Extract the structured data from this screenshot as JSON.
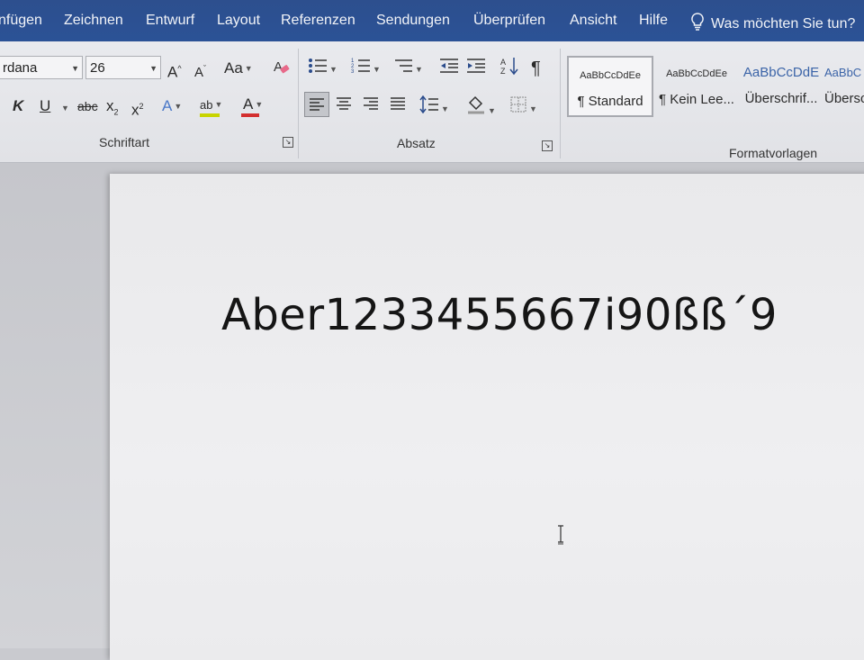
{
  "menu": {
    "tabs": [
      "nfügen",
      "Zeichnen",
      "Entwurf",
      "Layout",
      "Referenzen",
      "Sendungen",
      "Überprüfen",
      "Ansicht",
      "Hilfe"
    ],
    "tell_me": "Was möchten Sie tun?"
  },
  "font_group": {
    "font_name": "rdana",
    "font_size": "26",
    "grow_label": "A",
    "shrink_label": "A",
    "case_label": "Aa",
    "bold": "K",
    "underline": "U",
    "strike": "abc",
    "subscript": "x",
    "subscript_small": "2",
    "superscript": "x",
    "superscript_small": "2",
    "effects": "A",
    "highlight": "ab",
    "font_color": "A",
    "label": "Schriftart"
  },
  "paragraph_group": {
    "pilcrow": "¶",
    "label": "Absatz"
  },
  "styles_group": {
    "styles": [
      {
        "sample": "AaBbCcDdEe",
        "name": "¶ Standard"
      },
      {
        "sample": "AaBbCcDdEe",
        "name": "¶ Kein Lee..."
      },
      {
        "sample": "AaBbCcDdE",
        "name": "Überschrif..."
      },
      {
        "sample": "AaBbC",
        "name": "Übersc"
      }
    ],
    "label": "Formatvorlagen"
  },
  "document": {
    "text": "Aber1233455667i90ßß´9"
  },
  "colors": {
    "menubar": "#2b5296",
    "highlight_bar": "#c8d400",
    "font_color_bar": "#d32f2f"
  }
}
